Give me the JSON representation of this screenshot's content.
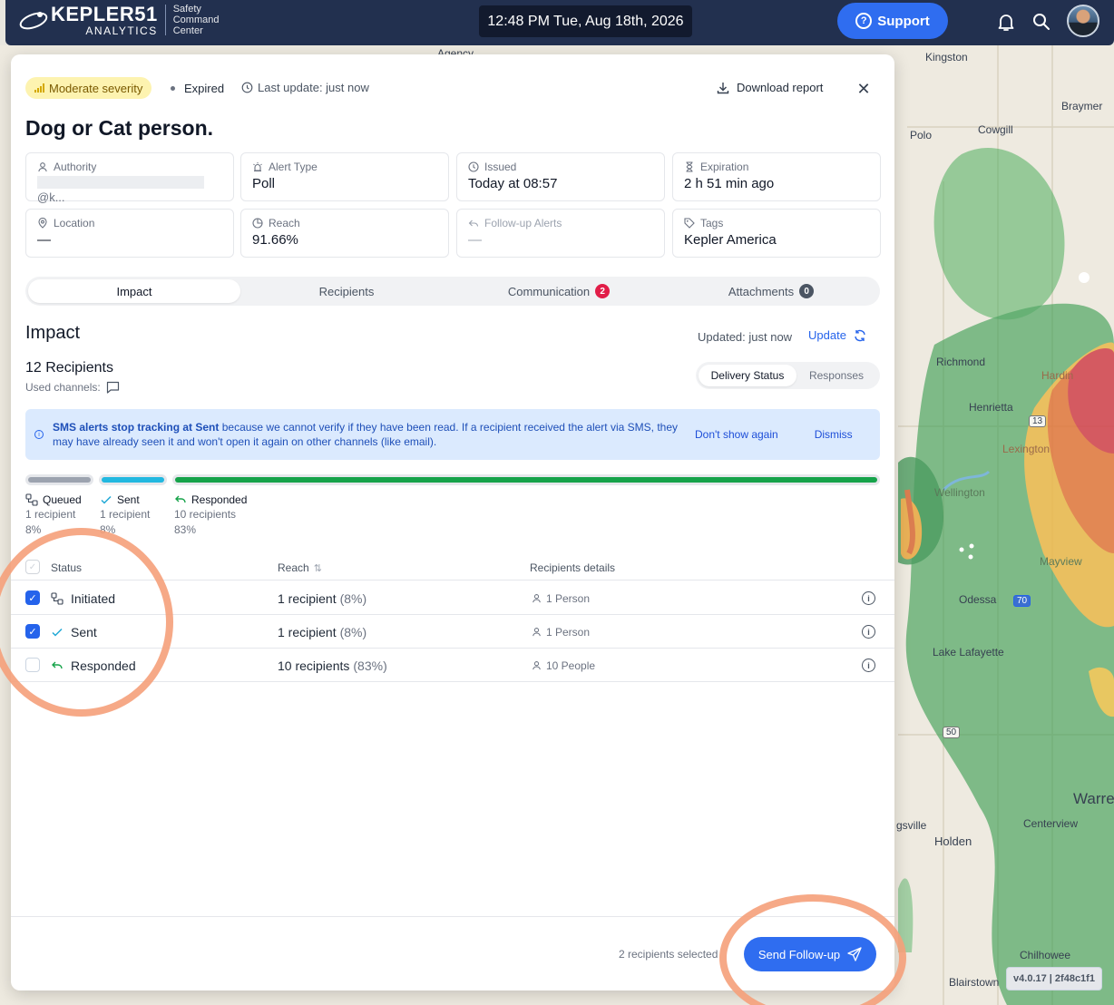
{
  "topbar": {
    "brand": "KEPLER51",
    "brand_sub": "ANALYTICS",
    "product_lines": [
      "Safety",
      "Command",
      "Center"
    ],
    "clock": "12:48 PM Tue, Aug 18th, 2026",
    "support_label": "Support",
    "icons": [
      "logo-icon",
      "bell-icon",
      "search-icon",
      "avatar"
    ]
  },
  "map": {
    "labels": [
      "Agency",
      "Kingston",
      "Braymer",
      "Polo",
      "Cowgill",
      "Richmond",
      "Hardin",
      "Henrietta",
      "Lexington",
      "Wellington",
      "Mayview",
      "Odessa",
      "Lake Lafayette",
      "Warre",
      "Centerview",
      "gsville",
      "Holden",
      "Chilhowee",
      "Blairstown"
    ],
    "shields": [
      "13",
      "50",
      "70"
    ],
    "version": "v4.0.17 | 2f48c1f1"
  },
  "alert": {
    "severity": "Moderate severity",
    "state": "Expired",
    "last_update": "Last update: just now",
    "download_label": "Download report",
    "title": "Dog or Cat person.",
    "cards": [
      {
        "label": "Authority",
        "value": "@k...",
        "icon": "user-icon"
      },
      {
        "label": "Alert Type",
        "value": "Poll",
        "icon": "siren-icon"
      },
      {
        "label": "Issued",
        "value": "Today at 08:57",
        "icon": "clock-icon"
      },
      {
        "label": "Expiration",
        "value": "2 h 51 min ago",
        "icon": "hourglass-icon"
      },
      {
        "label": "Location",
        "value": "—",
        "icon": "pin-icon"
      },
      {
        "label": "Reach",
        "value": "91.66%",
        "icon": "pie-icon"
      },
      {
        "label": "Follow-up Alerts",
        "value": "—",
        "icon": "reply-icon"
      },
      {
        "label": "Tags",
        "value": "Kepler America",
        "icon": "tag-icon"
      }
    ]
  },
  "tabs": [
    {
      "label": "Impact",
      "badge": ""
    },
    {
      "label": "Recipients",
      "badge": ""
    },
    {
      "label": "Communication",
      "badge": "2"
    },
    {
      "label": "Attachments",
      "badge": "0"
    }
  ],
  "impact": {
    "heading": "Impact",
    "updated": "Updated: just now",
    "update_label": "Update",
    "recipients": "12 Recipients",
    "used_channels": "Used channels:",
    "segments": [
      "Delivery Status",
      "Responses"
    ],
    "info_bold": "SMS alerts stop tracking at Sent",
    "info_rest": " because we cannot verify if they have been read. If a recipient received the alert via SMS, they may have already seen it and won't open it again on other channels (like email).",
    "dont_show": "Don't show again",
    "dismiss": "Dismiss",
    "progress": [
      {
        "name": "Queued",
        "count": "1 recipient",
        "pct": "8%",
        "fraction": 0.08,
        "color": "#9ca3af"
      },
      {
        "name": "Sent",
        "count": "1 recipient",
        "pct": "8%",
        "fraction": 0.08,
        "color": "#22b8e0"
      },
      {
        "name": "Responded",
        "count": "10 recipients",
        "pct": "83%",
        "fraction": 0.83,
        "color": "#16a34a"
      }
    ]
  },
  "table": {
    "headers": [
      "Status",
      "Reach",
      "Recipients details"
    ],
    "rows": [
      {
        "status": "Initiated",
        "reach": "1 recipient",
        "reach_pct": "(8%)",
        "details": "1 Person",
        "checked": true
      },
      {
        "status": "Sent",
        "reach": "1 recipient",
        "reach_pct": "(8%)",
        "details": "1 Person",
        "checked": true
      },
      {
        "status": "Responded",
        "reach": "10 recipients",
        "reach_pct": "(83%)",
        "details": "10 People",
        "checked": false
      }
    ]
  },
  "footer": {
    "selected": "2 recipients selected",
    "send_label": "Send Follow-up"
  }
}
